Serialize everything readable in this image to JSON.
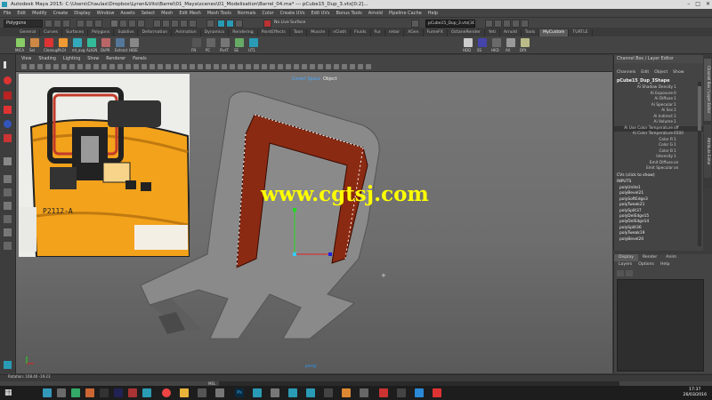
{
  "window": {
    "title": "Autodesk Maya 2015: C:\\Users\\Chaulax\\Dropbox\\Lyran&Vito\\Barrel\\01_Maya\\scenes\\01_Modelisation\\Barrel_04.ma* --- pCube15_Dup_3.vtx[0:2]..."
  },
  "menubar": {
    "items": [
      "File",
      "Edit",
      "Modify",
      "Create",
      "Display",
      "Window",
      "Assets",
      "Select",
      "Mesh",
      "Edit Mesh",
      "Mesh Tools",
      "Normals",
      "Color",
      "Create UVs",
      "Edit UVs",
      "Bonus Tools",
      "Arnold",
      "Pipeline Cache",
      "Help"
    ]
  },
  "statusline": {
    "mode": "Polygons",
    "no_live_surface": "No Live Surface",
    "selection_field": "pCube15_Dup_3.vtx[308:322]"
  },
  "shelf": {
    "tabs": [
      "General",
      "Curves",
      "Surfaces",
      "Polygons",
      "Subdivs",
      "Deformation",
      "Animation",
      "Dynamics",
      "Rendering",
      "PaintEffects",
      "Toon",
      "Muscle",
      "nCloth",
      "Fluids",
      "Fur",
      "nHair",
      "XGen",
      "FumeFX",
      "OctaneRender",
      "Yeti",
      "Arnold",
      "Tools",
      "MyCustom",
      "TURTLE"
    ],
    "active_tab": "MyCustom",
    "icon_labels": [
      "MICA",
      "Sel",
      "Cleanup",
      "PLOI",
      "ml_avg",
      "ALIGN",
      "DkPR",
      "Extract",
      "HIDE",
      "FN",
      "PC",
      "PivtT",
      "SE",
      "UT1",
      "HDD",
      "SS",
      "HKD",
      "All",
      "Dflt"
    ]
  },
  "viewport": {
    "menu": [
      "View",
      "Shading",
      "Lighting",
      "Show",
      "Renderer",
      "Panels"
    ],
    "space_labels": [
      "Covert Space",
      "Object"
    ],
    "axis_label": "persp"
  },
  "channel_box": {
    "header": "Channel Box / Layer Editor",
    "menu": [
      "Channels",
      "Edit",
      "Object",
      "Show"
    ],
    "object_name": "pCube15_Dup_3Shape",
    "attributes": [
      {
        "name": "Ai Shadow Density",
        "value": "1"
      },
      {
        "name": "Ai Exposure",
        "value": "0"
      },
      {
        "name": "Ai Diffuse",
        "value": "1"
      },
      {
        "name": "Ai Specular",
        "value": "1"
      },
      {
        "name": "Ai Sss",
        "value": "1"
      },
      {
        "name": "Ai Indirect",
        "value": "1"
      },
      {
        "name": "Ai Volume",
        "value": "1"
      },
      {
        "name": "Ai Use Color Temperature",
        "value": "off"
      },
      {
        "name": "Ai Color Temperature",
        "value": "6500"
      },
      {
        "name": "Color R",
        "value": "1"
      },
      {
        "name": "Color G",
        "value": "1"
      },
      {
        "name": "Color B",
        "value": "1"
      },
      {
        "name": "Intensity",
        "value": "1"
      },
      {
        "name": "Emit Diffuse",
        "value": "on"
      },
      {
        "name": "Emit Specular",
        "value": "on"
      }
    ],
    "cvs": "CVs (click to show)",
    "inputs_label": "INPUTS",
    "inputs": [
      "polyUnite1",
      "polyBevel21",
      "polySoftEdge3",
      "polyTweak21",
      "polySplit37",
      "polyDelEdge15",
      "polyDelEdge14",
      "polySplit36",
      "polyTweak19",
      "polyBevel20"
    ]
  },
  "layer_editor": {
    "tabs": [
      "Display",
      "Render",
      "Anim"
    ],
    "menu": [
      "Layers",
      "Options",
      "Help"
    ]
  },
  "right_tabs": [
    "Channel Box / Layer Editor",
    "Attribute Editor"
  ],
  "helpline": {
    "rotation": "Rotation: 108.40 -19.23",
    "mel": "MEL"
  },
  "reference_image": {
    "label": "P2112-A"
  },
  "taskbar": {
    "time": "17:37",
    "date": "26/03/2016"
  },
  "watermark": "www.cgtsj.com",
  "colors": {
    "accent": "#2a9bb5",
    "barrel_orange": "#f3a21b",
    "mesh_red": "#8b2a12",
    "watermark": "#ffff00"
  }
}
